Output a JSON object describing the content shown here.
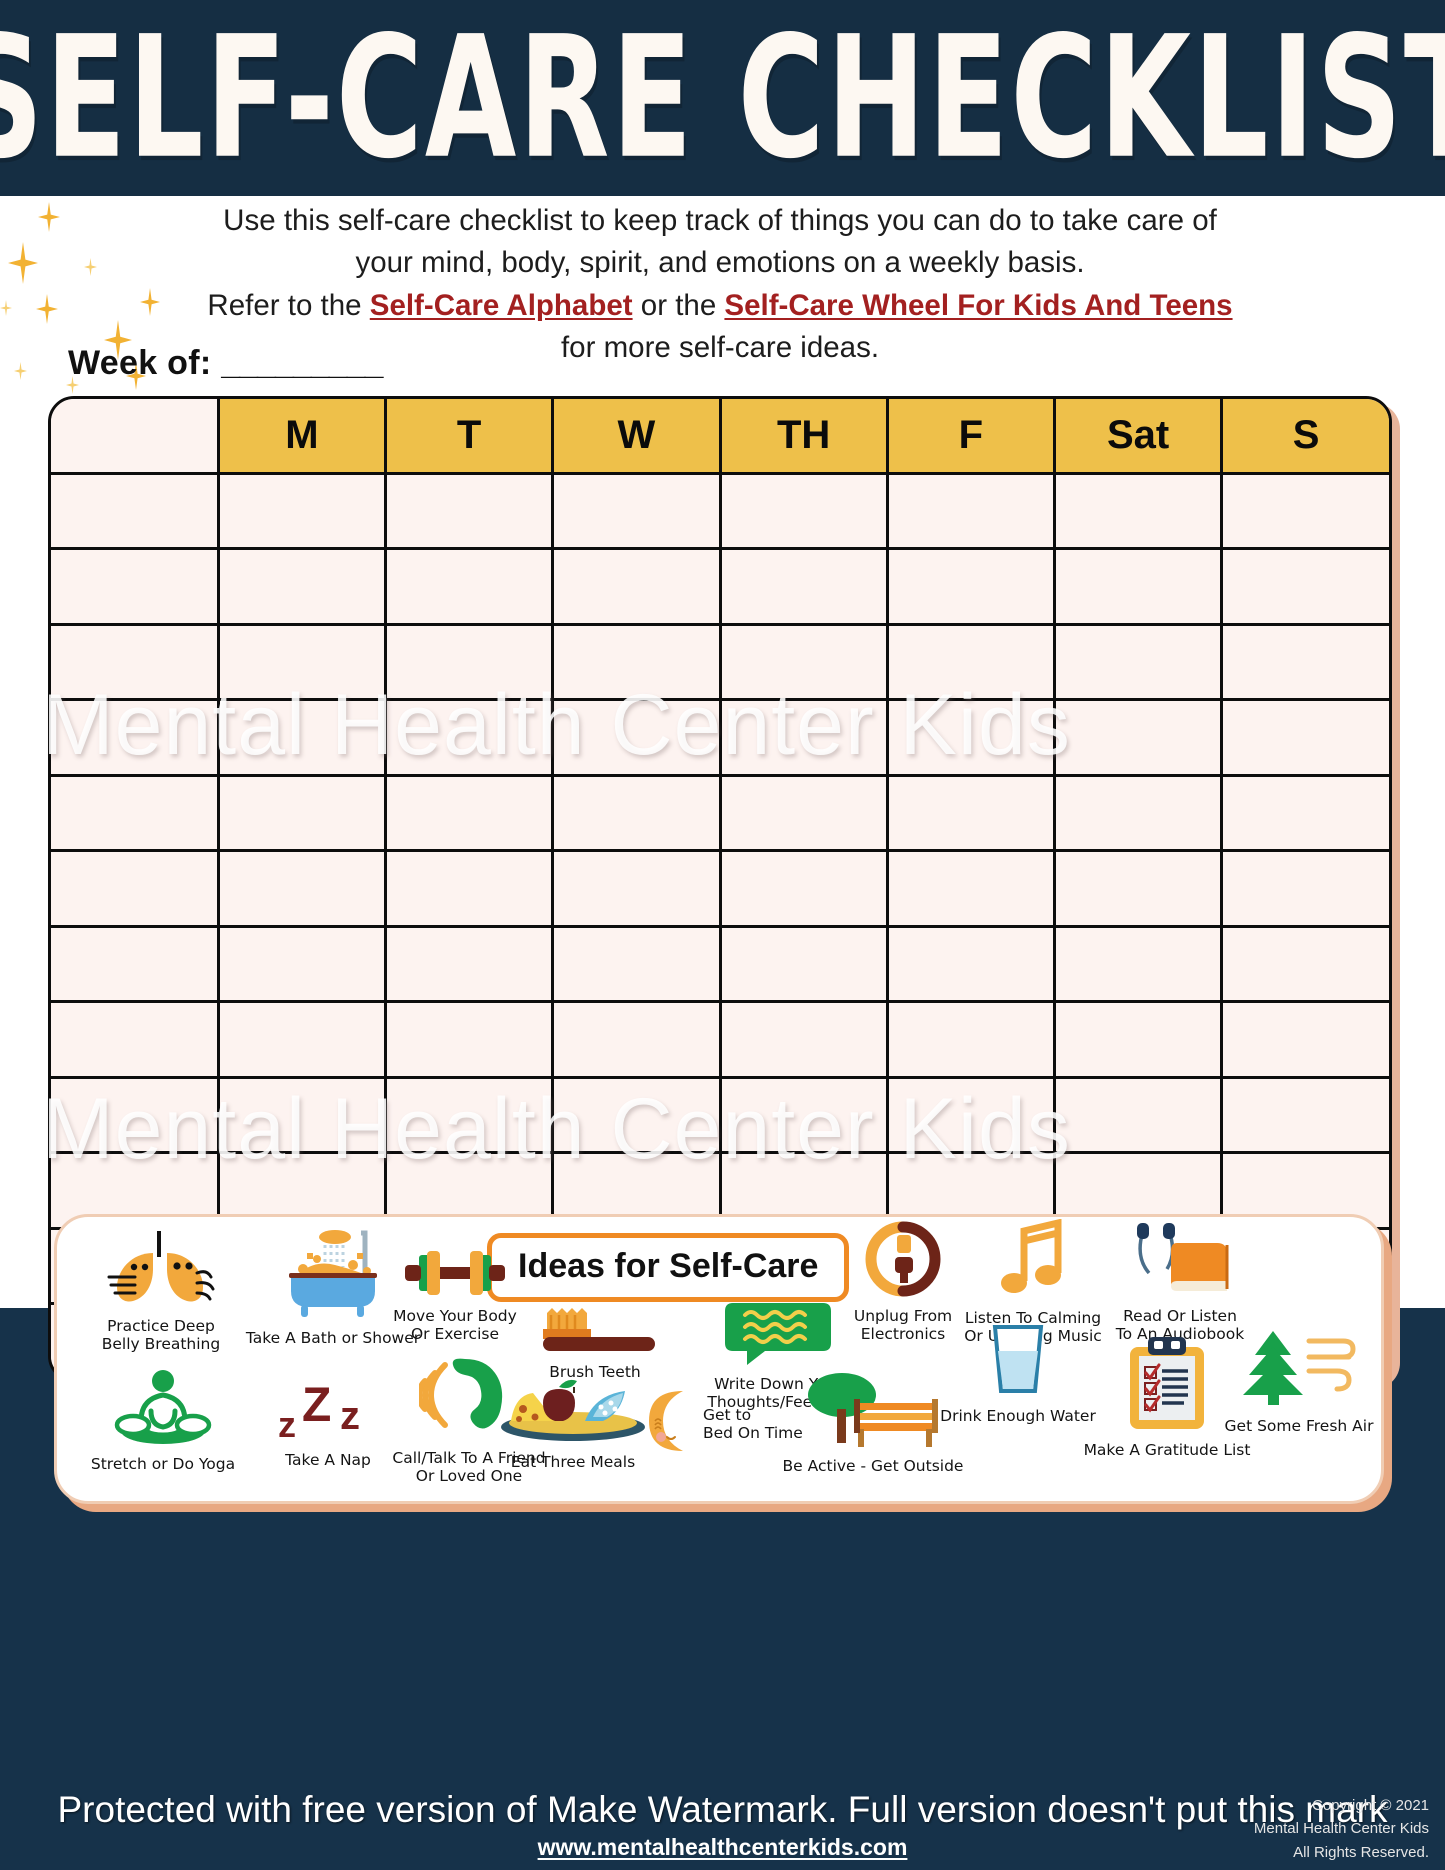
{
  "header": {
    "title": "SELF-CARE CHECKLIST"
  },
  "intro": {
    "line1": "Use this self-care checklist to keep track of things you can do to take care of",
    "line2": "your mind, body, spirit, and emotions on a weekly basis.",
    "line3_prefix": "Refer to the ",
    "link1": "Self-Care Alphabet",
    "line3_middle": " or the ",
    "link2": "Self-Care Wheel For Kids And Teens",
    "line4": "for more self-care ideas."
  },
  "week": {
    "label": "Week of:",
    "blank": "_________"
  },
  "table": {
    "task_column_header": "",
    "day_headers": [
      "M",
      "T",
      "W",
      "TH",
      "F",
      "Sat",
      "S"
    ],
    "row_count": 12,
    "rows": [
      {
        "task": ""
      },
      {
        "task": ""
      },
      {
        "task": ""
      },
      {
        "task": ""
      },
      {
        "task": ""
      },
      {
        "task": ""
      },
      {
        "task": ""
      },
      {
        "task": ""
      },
      {
        "task": ""
      },
      {
        "task": ""
      },
      {
        "task": ""
      },
      {
        "task": ""
      }
    ]
  },
  "watermark": {
    "overlay_text": "Mental Health Center Kids",
    "footer_notice": "Protected with free version of Make Watermark. Full version doesn't put this mark"
  },
  "ideas_panel": {
    "title": "Ideas for Self-Care",
    "items": [
      {
        "icon": "lungs-icon",
        "label": "Practice Deep\nBelly Breathing"
      },
      {
        "icon": "bathtub-icon",
        "label": "Take A Bath or Shower"
      },
      {
        "icon": "dumbbell-icon",
        "label": "Move Your Body\nOr Exercise"
      },
      {
        "icon": "toothbrush-icon",
        "label": "Brush Teeth"
      },
      {
        "icon": "speech-bubble-icon",
        "label": "Write Down Your\nThoughts/Feelings"
      },
      {
        "icon": "unplug-icon",
        "label": "Unplug From Electronics"
      },
      {
        "icon": "music-note-icon",
        "label": "Listen To Calming\nOr Uplifting Music"
      },
      {
        "icon": "earbuds-book-icon",
        "label": "Read Or Listen\nTo An Audiobook"
      },
      {
        "icon": "water-glass-icon",
        "label": "Drink Enough Water"
      },
      {
        "icon": "tree-wind-icon",
        "label": "Get Some Fresh Air"
      },
      {
        "icon": "yoga-icon",
        "label": "Stretch or Do Yoga"
      },
      {
        "icon": "zzz-icon",
        "label": "Take A Nap"
      },
      {
        "icon": "phone-call-icon",
        "label": "Call/Talk To A Friend\nOr Loved One"
      },
      {
        "icon": "meal-plate-icon",
        "label": "Eat Three Meals"
      },
      {
        "icon": "moon-icon",
        "label": "Get to\nBed On Time"
      },
      {
        "icon": "bench-tree-icon",
        "label": "Be Active - Get Outside"
      },
      {
        "icon": "clipboard-icon",
        "label": "Make A Gratitude List"
      }
    ]
  },
  "footer": {
    "site": "www.mentalhealthcenterkids.com",
    "copyright_line1": "Copyright © 2021",
    "copyright_line2": "Mental Health Center Kids",
    "copyright_line3": "All Rights Reserved."
  },
  "colors": {
    "navy": "#152e43",
    "cream": "#fdf3f0",
    "day_header_gold": "#eec04a",
    "link_red": "#a32020",
    "orange": "#ef8a23",
    "peach_border": "#e8a882",
    "green": "#18a04a",
    "dark_red": "#7a1f1f"
  }
}
